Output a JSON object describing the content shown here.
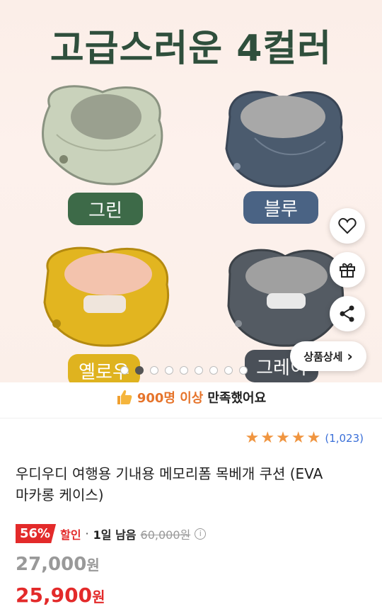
{
  "hero": {
    "title": "고급스러운 4컬러",
    "colors": [
      {
        "label": "그린",
        "pillow": "#c9d2bb",
        "inner": "#9aa08f",
        "badge": "#3d6a48"
      },
      {
        "label": "블루",
        "pillow": "#4b5b6e",
        "inner": "#a8a8a8",
        "badge": "#4a6384"
      },
      {
        "label": "옐로우",
        "pillow": "#e2b520",
        "inner": "#f3c3ad",
        "badge": "#dfb31f"
      },
      {
        "label": "그레이",
        "pillow": "#545b63",
        "inner": "#a0a0a0",
        "badge": "#4a5058"
      }
    ],
    "dots": {
      "count": 9,
      "active": 1
    }
  },
  "actions": {
    "like_icon": "heart-icon",
    "gift_icon": "gift-icon",
    "share_icon": "share-icon",
    "detail_label": "상품상세",
    "detail_chevron": "›"
  },
  "satisfaction": {
    "icon": "thumbs-up-icon",
    "highlight": "900명 이상",
    "rest": "만족했어요"
  },
  "rating": {
    "stars": 5,
    "count": "(1,023)"
  },
  "product": {
    "title_line1": "우디우디 여행용 기내용 메모리폼 목베개 쿠션 (EVA",
    "title_line2": "마카롱 케이스)"
  },
  "price": {
    "discount": "56%",
    "sale_word": "할인",
    "separator": "·",
    "remaining": "1일 남음",
    "original": "60,000원",
    "price1_num": "27,000",
    "price1_unit": "원",
    "price2_num": "25,900",
    "price2_unit": "원",
    "accent": "#e32a2a"
  }
}
